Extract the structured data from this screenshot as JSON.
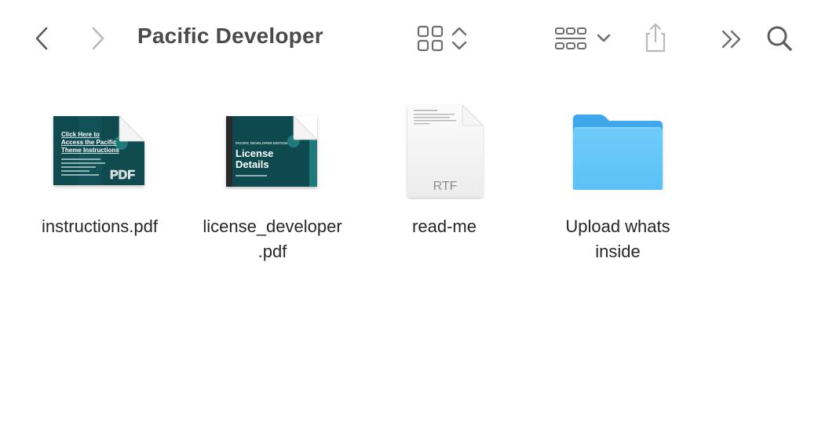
{
  "window": {
    "title": "Pacific Developer"
  },
  "toolbar": {
    "back_icon": "chevron-left-icon",
    "forward_icon": "chevron-right-icon",
    "view_icon": "grid-view-icon",
    "sort_icon": "up-down-chevron-icon",
    "group_icon": "group-grid-icon",
    "group_dropdown_icon": "chevron-down-icon",
    "share_icon": "share-icon",
    "more_icon": "double-chevron-right-icon",
    "search_icon": "search-icon"
  },
  "colors": {
    "pdf_cover": "#0f4a4f",
    "pdf_accent": "#1f7a7a",
    "folder_light": "#5ec2f7",
    "folder_dark": "#3ca8ec",
    "toolbar_icon": "#6e6e6e"
  },
  "files": [
    {
      "name": "instructions.pdf",
      "type": "pdf",
      "badge": "PDF",
      "cover_lines": [
        "Click Here to",
        "Access the Pacific",
        "Theme Instructions"
      ]
    },
    {
      "name": "license_developer\n.pdf",
      "line1": "license_developer",
      "line2": ".pdf",
      "type": "pdf",
      "cover_small": "PACIFIC DEVELOPER EDITION",
      "cover_lines": [
        "License",
        "Details"
      ]
    },
    {
      "name": "read-me",
      "type": "rtf",
      "badge": "RTF"
    },
    {
      "name": "Upload whats inside",
      "line1": "Upload whats",
      "line2": "inside",
      "type": "folder"
    }
  ]
}
